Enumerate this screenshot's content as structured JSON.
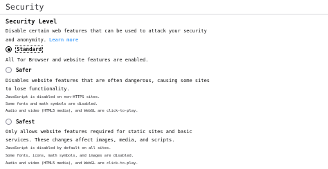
{
  "section": {
    "title": "Security"
  },
  "security_level": {
    "heading": "Security Level",
    "description": "Disable certain web features that can be used to attack your security and anonymity.",
    "learn_more": "Learn more"
  },
  "options": {
    "standard": {
      "label": "Standard",
      "selected": true,
      "description": "All Tor Browser and website features are enabled."
    },
    "safer": {
      "label": "Safer",
      "selected": false,
      "description": "Disables website features that are often dangerous, causing some sites to lose functionality.",
      "details": [
        "JavaScript is disabled on non-HTTPS sites.",
        "Some fonts and math symbols are disabled.",
        "Audio and video (HTML5 media), and WebGL are click-to-play."
      ]
    },
    "safest": {
      "label": "Safest",
      "selected": false,
      "description": "Only allows website features required for static sites and basic services. These changes affect images, media, and scripts.",
      "details": [
        "JavaScript is disabled by default on all sites.",
        "Some fonts, icons, math symbols, and images are disabled.",
        "Audio and video (HTML5 media), and WebGL are click-to-play."
      ]
    }
  }
}
